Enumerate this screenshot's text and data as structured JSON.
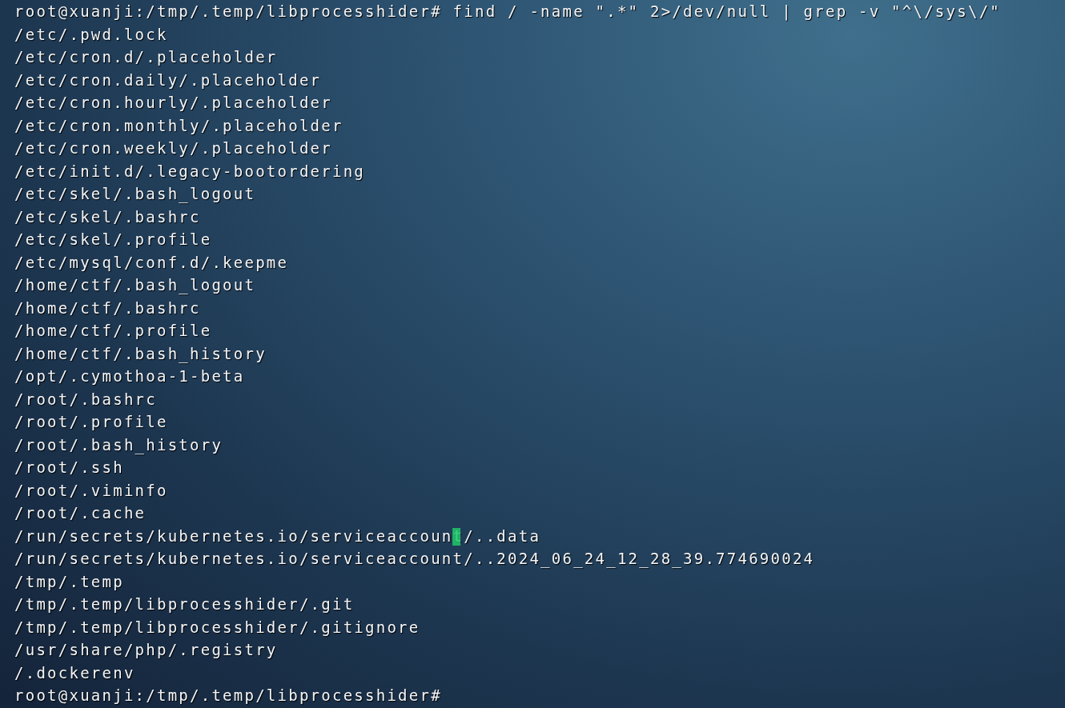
{
  "terminal": {
    "lines": [
      "root@xuanji:/tmp/.temp/libprocesshider# find / -name \".*\" 2>/dev/null | grep -v \"^\\/sys\\/\"",
      "/etc/.pwd.lock",
      "/etc/cron.d/.placeholder",
      "/etc/cron.daily/.placeholder",
      "/etc/cron.hourly/.placeholder",
      "/etc/cron.monthly/.placeholder",
      "/etc/cron.weekly/.placeholder",
      "/etc/init.d/.legacy-bootordering",
      "/etc/skel/.bash_logout",
      "/etc/skel/.bashrc",
      "/etc/skel/.profile",
      "/etc/mysql/conf.d/.keepme",
      "/home/ctf/.bash_logout",
      "/home/ctf/.bashrc",
      "/home/ctf/.profile",
      "/home/ctf/.bash_history",
      "/opt/.cymothoa-1-beta",
      "/root/.bashrc",
      "/root/.profile",
      "/root/.bash_history",
      "/root/.ssh",
      "/root/.viminfo",
      "/root/.cache",
      "/run/secrets/kubernetes.io/serviceaccount/..data",
      "/run/secrets/kubernetes.io/serviceaccount/..2024_06_24_12_28_39.774690024",
      "/tmp/.temp",
      "/tmp/.temp/libprocesshider/.git",
      "/tmp/.temp/libprocesshider/.gitignore",
      "/usr/share/php/.registry",
      "/.dockerenv",
      "root@xuanji:/tmp/.temp/libprocesshider#"
    ]
  }
}
